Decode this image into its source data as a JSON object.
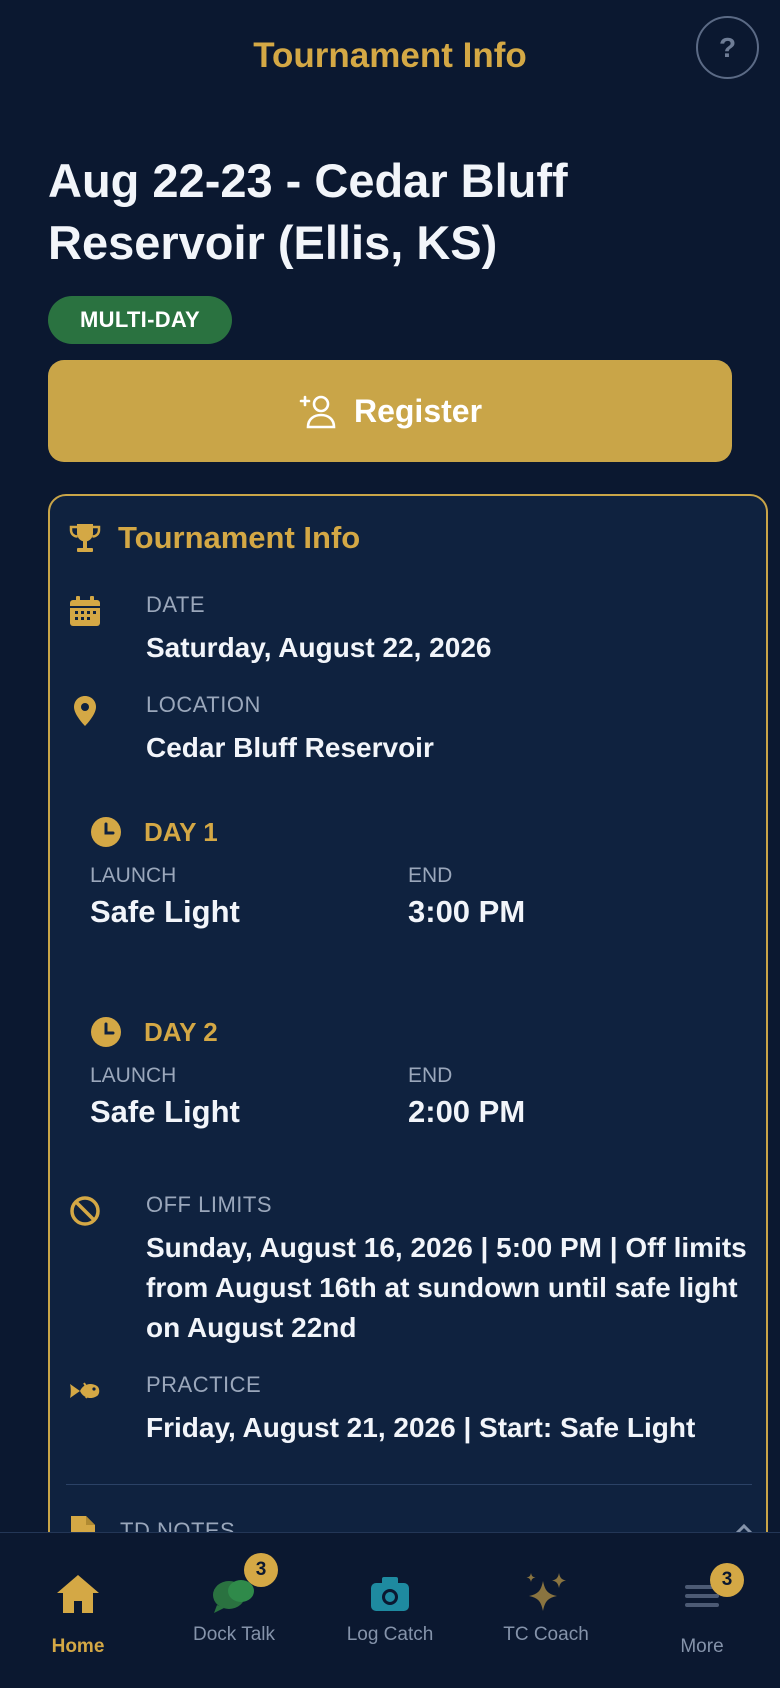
{
  "header": {
    "title": "Tournament Info",
    "help_label": "?"
  },
  "event": {
    "title": "Aug 22-23 - Cedar Bluff Reservoir (Ellis, KS)",
    "type_badge": "MULTI-DAY",
    "register_label": "Register"
  },
  "info_card": {
    "heading": "Tournament Info",
    "date": {
      "label": "DATE",
      "value": "Saturday, August 22, 2026"
    },
    "location": {
      "label": "LOCATION",
      "value": "Cedar Bluff Reservoir"
    },
    "days": [
      {
        "title": "DAY 1",
        "launch_label": "LAUNCH",
        "launch_value": "Safe Light",
        "end_label": "END",
        "end_value": "3:00 PM"
      },
      {
        "title": "DAY 2",
        "launch_label": "LAUNCH",
        "launch_value": "Safe Light",
        "end_label": "END",
        "end_value": "2:00 PM"
      }
    ],
    "off_limits": {
      "label": "OFF LIMITS",
      "value": "Sunday, August 16, 2026 | 5:00 PM | Off limits from August 16th at sundown until safe light on August 22nd"
    },
    "practice": {
      "label": "PRACTICE",
      "value": "Friday, August 21, 2026 | Start: Safe Light"
    },
    "notes": {
      "label": "TD NOTES"
    }
  },
  "tabbar": {
    "tabs": [
      {
        "label": "Home",
        "icon": "home-icon",
        "active": true
      },
      {
        "label": "Dock Talk",
        "icon": "chat-icon",
        "badge": "3"
      },
      {
        "label": "Log Catch",
        "icon": "camera-icon"
      },
      {
        "label": "TC Coach",
        "icon": "sparkle-icon"
      },
      {
        "label": "More",
        "icon": "menu-icon",
        "badge": "3"
      }
    ]
  },
  "colors": {
    "accent": "#c9a548",
    "background": "#0b1830",
    "card": "#0f223f",
    "badge_green": "#2a7240"
  }
}
